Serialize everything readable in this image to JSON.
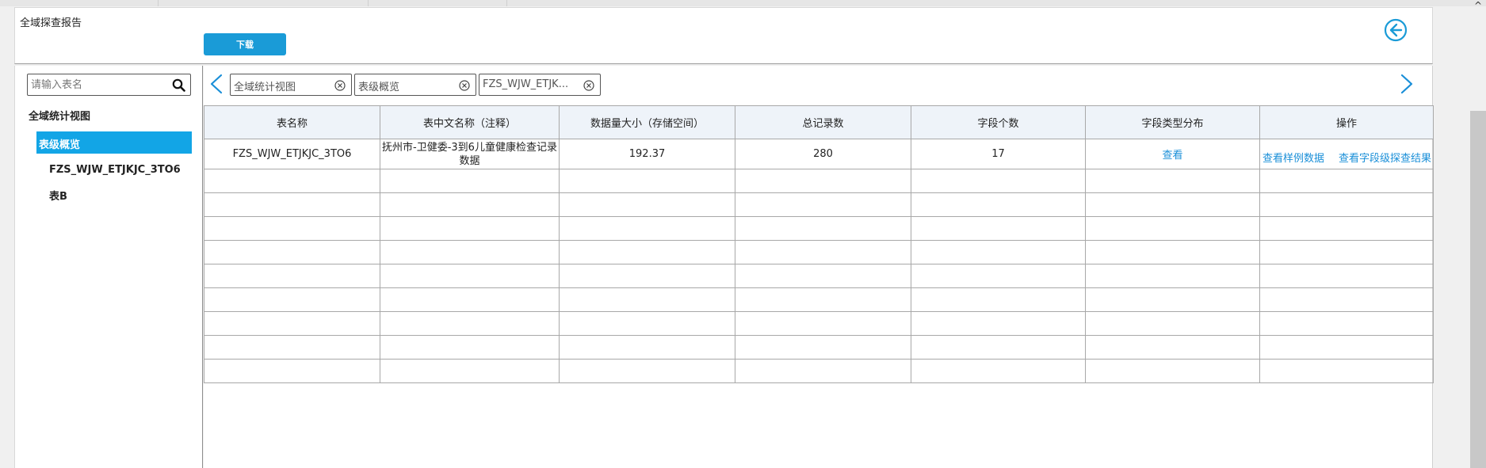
{
  "header": {
    "title": "全域探查报告",
    "download_label": "下载",
    "back_icon": "arrow-left-circle-icon"
  },
  "sidebar": {
    "search_placeholder": "请输入表名",
    "items": [
      {
        "label": "全域统计视图"
      },
      {
        "label": "表级概览",
        "selected": true
      },
      {
        "label": "FZS_WJW_ETJKJC_3TO6"
      },
      {
        "label": "表B"
      }
    ]
  },
  "tabs": [
    {
      "label": "全域统计视图"
    },
    {
      "label": "表级概览"
    },
    {
      "label": "FZS_WJW_ETJK..."
    }
  ],
  "table": {
    "columns": [
      "表名称",
      "表中文名称（注释）",
      "数据量大小（存储空间）",
      "总记录数",
      "字段个数",
      "字段类型分布",
      "操作"
    ],
    "rows": [
      {
        "name": "FZS_WJW_ETJKJC_3TO6",
        "comment": "抚州市-卫健委-3到6儿童健康检查记录数据",
        "size": "192.37",
        "records": "280",
        "fields": "17",
        "type_dist_link": "查看",
        "op_sample": "查看样例数据",
        "op_field_result": "查看字段级探查结果"
      }
    ]
  },
  "colors": {
    "accent": "#12a5e6",
    "button": "#1a9bd7",
    "link": "#1a8fd8",
    "header_bg": "#eef3f9"
  }
}
